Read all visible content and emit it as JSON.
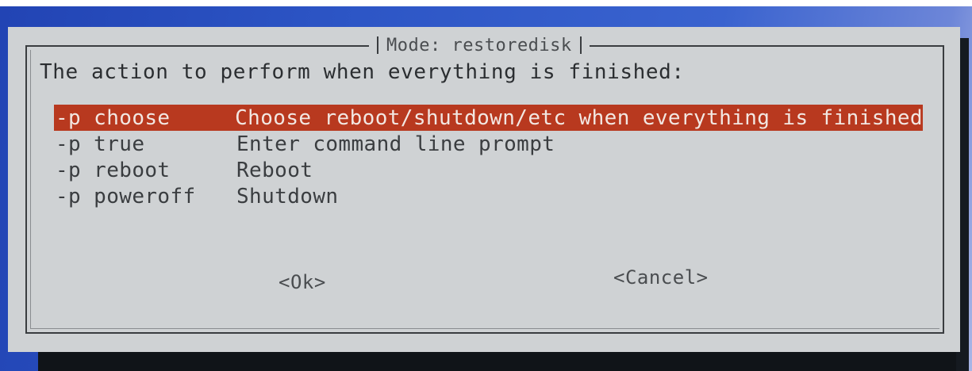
{
  "dialog": {
    "title": "Mode: restoredisk",
    "prompt": "The action to perform when everything is finished:"
  },
  "menu": {
    "items": [
      {
        "tag": "-p choose",
        "description": "Choose reboot/shutdown/etc when everything is finished",
        "selected": true
      },
      {
        "tag": "-p true",
        "description": "Enter command line prompt",
        "selected": false
      },
      {
        "tag": "-p reboot",
        "description": "Reboot",
        "selected": false
      },
      {
        "tag": "-p poweroff",
        "description": "Shutdown",
        "selected": false
      }
    ]
  },
  "buttons": {
    "ok_label": "<Ok>",
    "cancel_label": "<Cancel>"
  },
  "colors": {
    "background": "#2a4fb8",
    "dialog": "#cfd2d4",
    "selection": "#b8391f",
    "text": "#2b2e31"
  }
}
